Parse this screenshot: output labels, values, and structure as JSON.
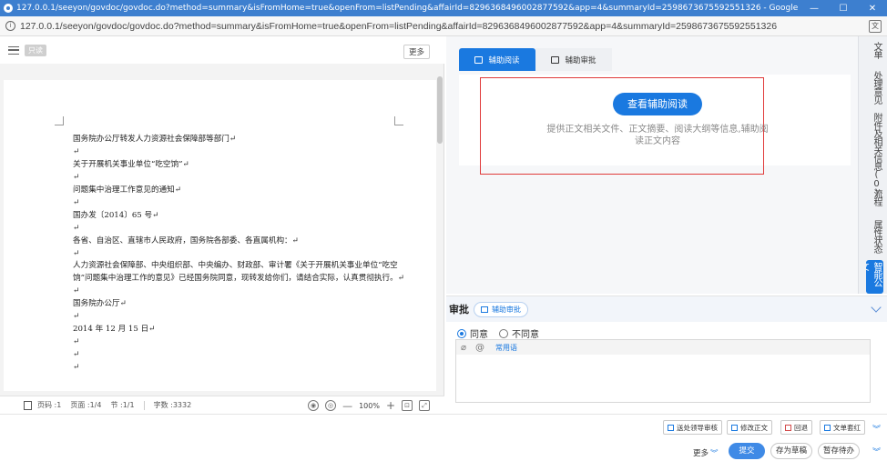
{
  "window": {
    "title": "127.0.0.1/seeyon/govdoc/govdoc.do?method=summary&isFromHome=true&openFrom=listPending&affairId=8296368496002877592&app=4&summaryId=2598673675592551326 - Google Chrome",
    "url": "127.0.0.1/seeyon/govdoc/govdoc.do?method=summary&isFromHome=true&openFrom=listPending&affairId=8296368496002877592&app=4&summaryId=2598673675592551326",
    "controls": {
      "minimize": "—",
      "maximize": "☐",
      "close": "✕"
    }
  },
  "doc_toolbar": {
    "tag": "只读",
    "more": "更多"
  },
  "document": {
    "lines": [
      "国务院办公厅转发人力资源社会保障部等部门↵",
      "↵",
      "关于开展机关事业单位“吃空饷”↵",
      "↵",
      "问题集中治理工作意见的通知↵",
      "↵",
      "国办发〔2014〕65 号↵",
      "↵",
      "各省、自治区、直辖市人民政府，国务院各部委、各直属机构：↵",
      "↵",
      "人力资源社会保障部、中央组织部、中央编办、财政部、审计署《关于开展机关事业单位“吃空饷”问题集中治理工作的意见》已经国务院同意，现转发给你们，请结合实际，认真贯彻执行。↵",
      "↵",
      "国务院办公厅↵",
      "↵",
      "2014 年 12 月 15 日↵",
      "↵",
      "↵",
      "↵"
    ]
  },
  "status_bar": {
    "page_no": "页码 :1",
    "page_count": "页面 :1/4",
    "section": "节 :1/1",
    "word_count": "字数 :3332",
    "zoom": "100%"
  },
  "right_tabs": {
    "assist_read": "辅助阅读",
    "assist_approve": "辅助审批"
  },
  "assist_panel": {
    "button": "查看辅助阅读",
    "description": "提供正文相关文件、正文摘要、阅读大纲等信息,辅助阅读正文内容"
  },
  "side_tabs": [
    "文单",
    "处理意见",
    "附件及相关信息(0)",
    "流程",
    "属性状态",
    "智能公文"
  ],
  "approval": {
    "title": "审批",
    "assist_button": "辅助审批",
    "options": [
      "同意",
      "不同意"
    ],
    "selected": "同意",
    "common_phrases": "常用语"
  },
  "actions": {
    "send_leader": "送处领导审核",
    "edit_text": "修改正文",
    "return": "回退",
    "red_header": "文单套红",
    "more": "更多",
    "submit": "提交",
    "save_draft": "存为草稿",
    "hold": "暂存待办"
  }
}
